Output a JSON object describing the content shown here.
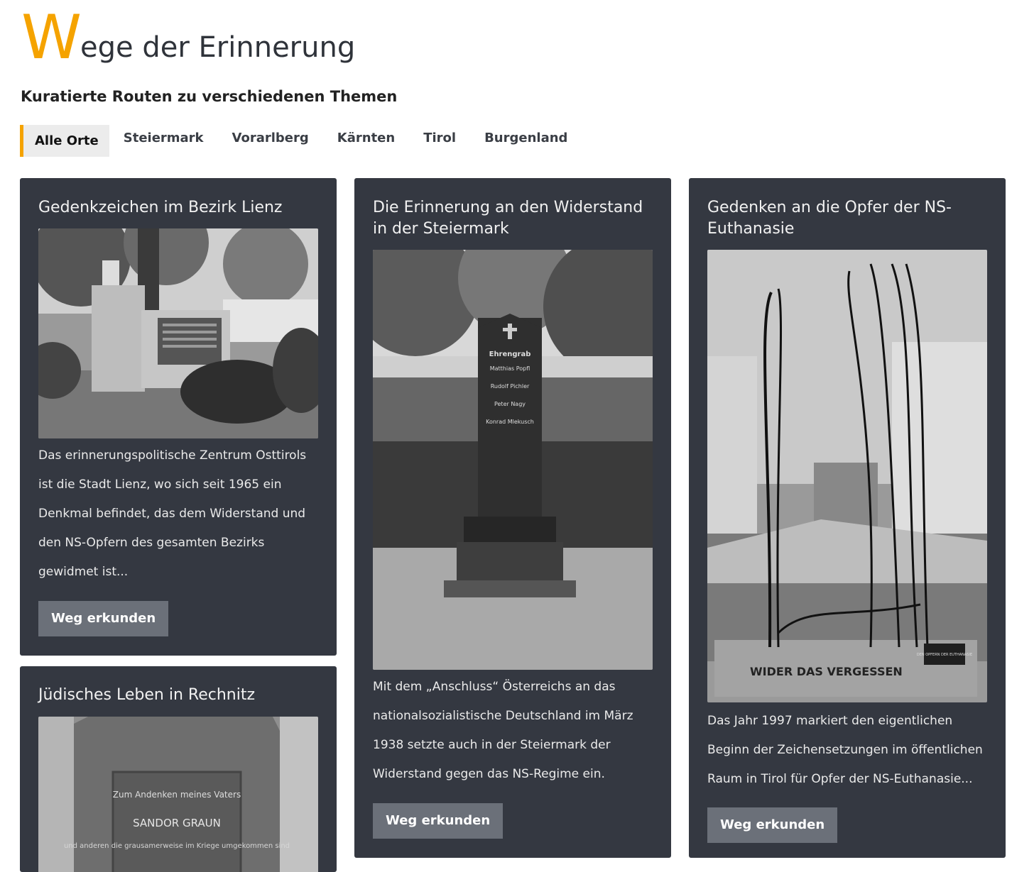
{
  "header": {
    "title_initial": "W",
    "title_rest": "ege der Erinnerung",
    "subtitle": "Kuratierte Routen zu verschiedenen Themen"
  },
  "filters": [
    "Alle Orte",
    "Steiermark",
    "Vorarlberg",
    "Kärnten",
    "Tirol",
    "Burgenland"
  ],
  "active_filter": "Alle Orte",
  "cards": [
    {
      "title": "Gedenkzeichen im Bezirk Lienz",
      "text": "Das erinnerungspolitische Zentrum Osttirols ist die Stadt Lienz, wo sich seit 1965 ein Denkmal befindet, das dem Widerstand und den NS-Opfern des gesamten Bezirks gewidmet ist...",
      "button": "Weg erkunden"
    },
    {
      "title": "Die Erinnerung an den Widerstand in der Steiermark",
      "text": "Mit dem „Anschluss“ Österreichs an das nationalsozialistische Deutschland im März 1938 setzte auch in der Steiermark der Widerstand gegen das NS-Regime ein.",
      "button": "Weg erkunden",
      "image_inscription": [
        "Ehrengrab",
        "Matthias Popfl",
        "Rudolf Pichler",
        "Peter Nagy",
        "Konrad Mlekusch"
      ]
    },
    {
      "title": "Gedenken an die Opfer der NS-Euthanasie",
      "text": "Das Jahr 1997 markiert den eigentlichen Beginn der Zeichensetzungen im öffentlichen Raum in Tirol für Opfer der NS-Euthanasie...",
      "button": "Weg erkunden",
      "image_inscription": [
        "WIDER DAS VERGESSEN",
        "DEN OPFERN DER EUTHANASIE"
      ]
    },
    {
      "title": "Jüdisches Leben in Rechnitz",
      "image_inscription": [
        "Zum Andenken meines Vaters",
        "SANDOR GRAUN",
        "und anderen die grausamerweise im Kriege umgekommen sind"
      ]
    }
  ],
  "colors": {
    "accent": "#f5a300",
    "card_bg": "#343841",
    "button_bg": "#6b7079"
  }
}
